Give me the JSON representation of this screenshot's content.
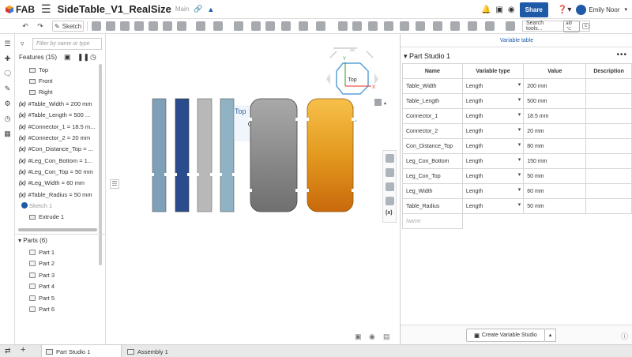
{
  "app": {
    "logo_text": "FAB",
    "doc_title": "SideTable_V1_RealSize",
    "branch": "Main"
  },
  "topbar": {
    "share_label": "Share",
    "user_name": "Emily Noor"
  },
  "toolbar": {
    "sketch_label": "Sketch",
    "search_label": "Search tools...",
    "search_kbd_1": "alt/⌥",
    "search_kbd_2": "c"
  },
  "feature_panel": {
    "filter_placeholder": "Filter by name or type",
    "features_header": "Features (15)",
    "planes": [
      "Top",
      "Front",
      "Right"
    ],
    "variables": [
      "#Table_Width = 200 mm",
      "#Table_Length = 500 ...",
      "#Connector_1 = 18.5 m...",
      "#Connector_2 = 20 mm",
      "#Con_Distance_Top = ...",
      "#Leg_Con_Bottom = 1...",
      "#Leg_Con_Top = 50 mm",
      "#Leg_Width = 60 mm",
      "#Table_Radius = 50 mm"
    ],
    "variable_icon": "(x)",
    "sketch_item": "Sketch 1",
    "extrude_item": "Extrude 1",
    "parts_header": "Parts (6)",
    "parts": [
      "Part 1",
      "Part 2",
      "Part 3",
      "Part 4",
      "Part 5",
      "Part 6"
    ]
  },
  "viewport": {
    "view_cube_label": "Top",
    "plane_label": "Top",
    "axis_x": "X",
    "axis_y": "Y",
    "colors": {
      "leg_light": "#7ea0b8",
      "leg_dark": "#2b4c8c",
      "leg_grey": "#b8b8b8",
      "leg_pale": "#8fb2c4",
      "top_grey": "#8c8c8c",
      "top_orange": "#e39a1e"
    }
  },
  "variable_table": {
    "header": "Variable table",
    "studio_label": "Part Studio 1",
    "columns": [
      "Name",
      "Variable type",
      "Value",
      "Description"
    ],
    "rows": [
      {
        "name": "Table_Width",
        "type": "Length",
        "value": "200 mm"
      },
      {
        "name": "Table_Length",
        "type": "Length",
        "value": "500 mm"
      },
      {
        "name": "Connector_1",
        "type": "Length",
        "value": "18.5 mm"
      },
      {
        "name": "Connector_2",
        "type": "Length",
        "value": "20 mm"
      },
      {
        "name": "Con_Distance_Top",
        "type": "Length",
        "value": "80 mm"
      },
      {
        "name": "Leg_Con_Bottom",
        "type": "Length",
        "value": "150 mm"
      },
      {
        "name": "Leg_Con_Top",
        "type": "Length",
        "value": "50 mm"
      },
      {
        "name": "Leg_Width",
        "type": "Length",
        "value": "60 mm"
      },
      {
        "name": "Table_Radius",
        "type": "Length",
        "value": "50 mm"
      }
    ],
    "name_placeholder": "Name",
    "create_button": "Create Variable Studio"
  },
  "tabs": {
    "items": [
      "Part Studio 1",
      "Assembly 1"
    ],
    "active": "Part Studio 1"
  }
}
